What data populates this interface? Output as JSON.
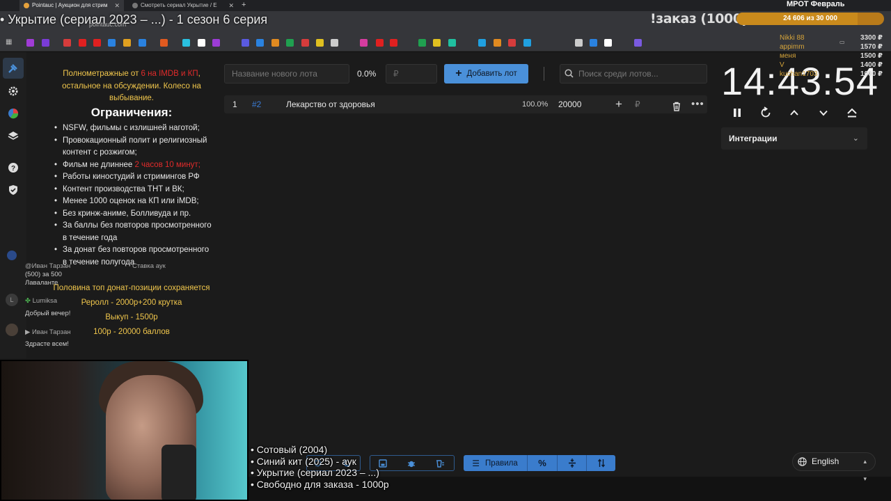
{
  "browser": {
    "tabs": [
      {
        "label": "Pointauc | Аукцион для стрим"
      },
      {
        "label": "Смотреть сериал Укрытие / E"
      }
    ],
    "url": "pointauc.com"
  },
  "overlay": {
    "stream_title": "• Укрытие (сериал 2023 – ...) - 1 сезон 6 серия",
    "order_label": "!заказ (1000р)",
    "goal": {
      "title": "МРОТ Февраль",
      "text": "24 606  из 30 000",
      "current": 24606,
      "target": 30000,
      "fill_color": "#c98a1c"
    },
    "donors": [
      "Nikki 88",
      "appimm",
      "меня",
      "V",
      "kuchan1703"
    ],
    "amounts": [
      "3300 ₽",
      "1570 ₽",
      "1500 ₽",
      "1400 ₽",
      "1000 ₽"
    ],
    "playlist": [
      "• Сотовый (2004)",
      "• Синий кит (2025) - аук",
      "• Укрытие (сериал 2023 – ...)",
      "• Свободно для заказа - 1000р"
    ]
  },
  "rules": {
    "intro_a": "Полнометражные от ",
    "intro_red": "6 на IMDB и КП",
    "intro_b": ", остальное на обсуждении. Колесо на выбывание.",
    "heading": "Ограничения:",
    "items": [
      "NSFW, фильмы с излишней наготой;",
      "Провокационный полит и религиозный контент с розжигом;",
      "Фильм не длиннее ",
      "Работы киностудий и стримингов РФ",
      "Контент производства ТНТ и ВК;",
      "Менее 1000 оценок на КП или iMDB;",
      "Без кринж-аниме, Болливуда и пр.",
      "За баллы без повторов просмотренного в течение года",
      "За донат без повторов просмотренного в течение полугода"
    ],
    "item3_red": "2 часов 10 минут;",
    "notes": [
      "Половина топ донат-позиции сохраняется",
      "Реролл - 2000р+200 крутка",
      "Выкуп - 1500р",
      "100р - 20000 баллов"
    ]
  },
  "chat": {
    "messages": [
      {
        "user": "@Иван Тарзан",
        "text": "Ставка аук"
      },
      {
        "user": "(500) за 500",
        "text": "Лаваланте"
      },
      {
        "user": "Lumiksa",
        "text": "Добрый вечер!"
      },
      {
        "user": "Иван Тарзан",
        "text": "Здрасте всем!"
      }
    ]
  },
  "lots": {
    "name_placeholder": "Название нового лота",
    "percent": "0.0%",
    "amount_placeholder": "₽",
    "add_label": "Добавить лот",
    "search_placeholder": "Поиск среди лотов...",
    "rows": [
      {
        "index": "1",
        "id": "#2",
        "name": "Лекарство от здоровья",
        "percent": "100.0%",
        "amount": "20000",
        "currency": "₽"
      }
    ]
  },
  "timer": {
    "value": "14:43:54",
    "integrations_label": "Интеграции"
  },
  "toolbar": {
    "rules_label": "Правила"
  },
  "language": {
    "selected": "English"
  },
  "colors": {
    "accent": "#4a90d9",
    "highlight": "#f0c64c",
    "warning": "#e02b2b",
    "background": "#1b1b1b"
  }
}
